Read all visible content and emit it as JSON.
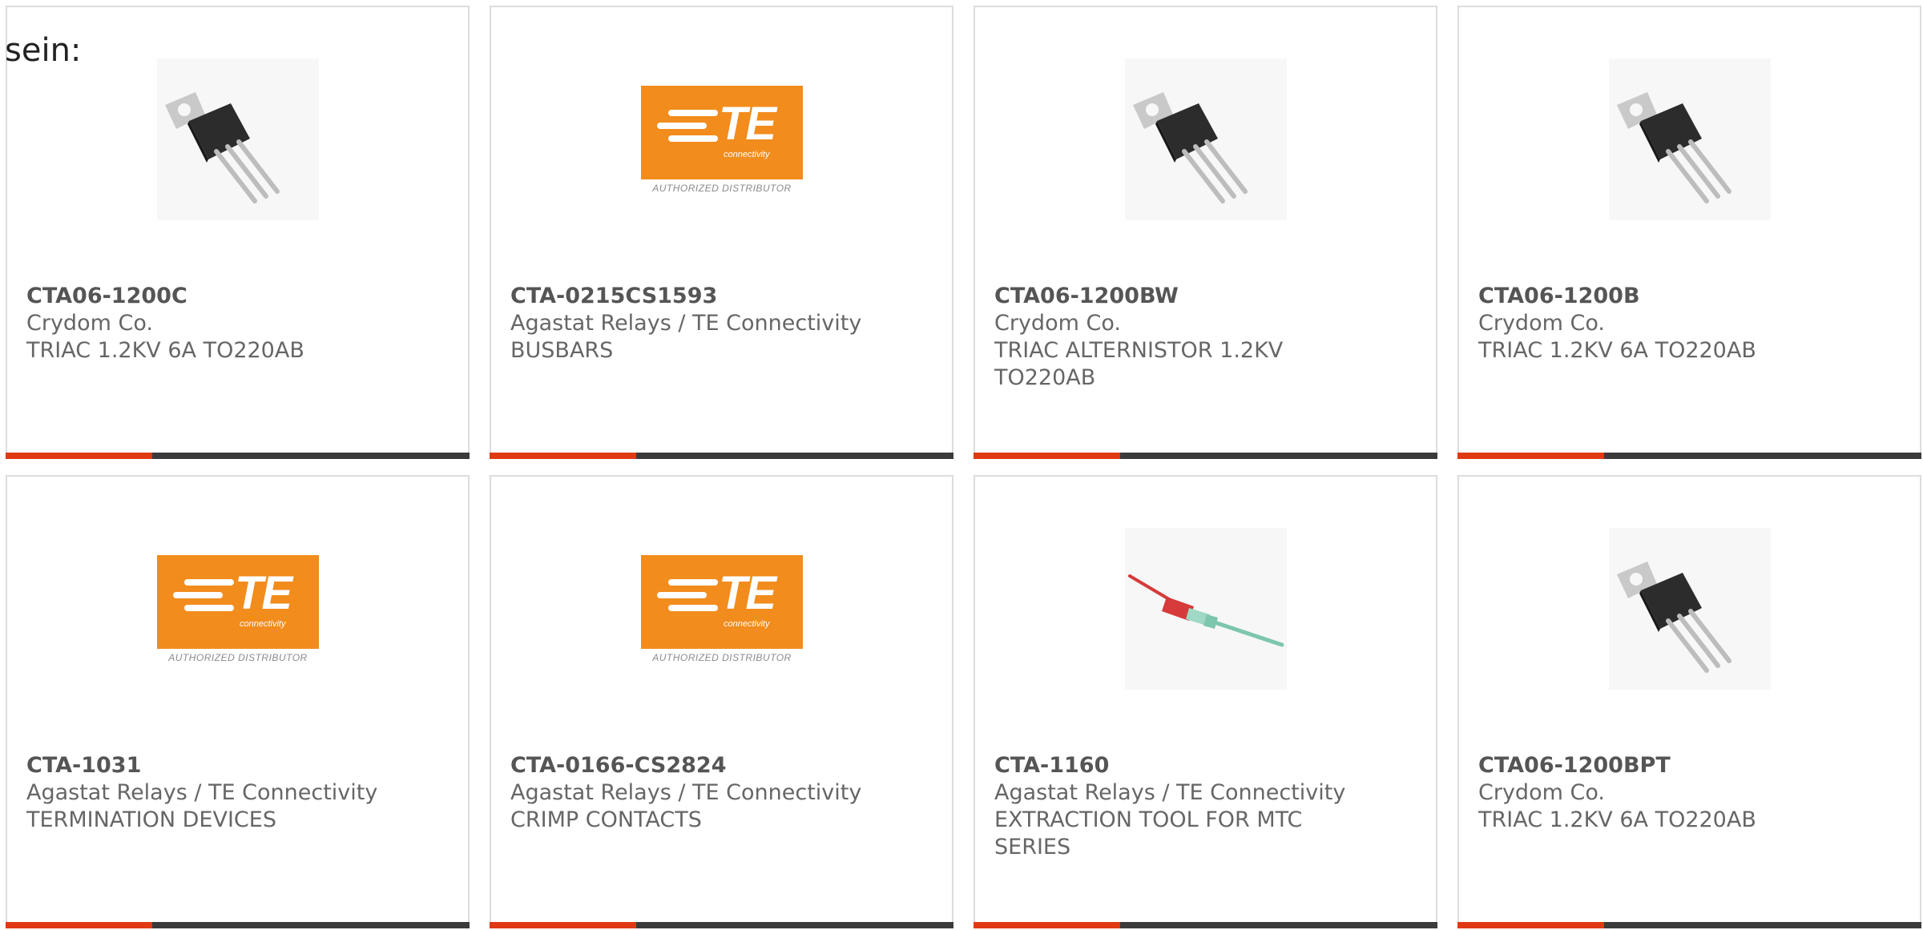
{
  "intro_text": "sein:",
  "colors": {
    "accent_bar": "#e03a12",
    "bar": "#3b3b3b",
    "te_orange": "#f28c1c"
  },
  "products": [
    {
      "part": "CTA06-1200C",
      "maker": "Crydom Co.",
      "desc": "TRIAC 1.2KV 6A TO220AB",
      "image": "to220-transistor-icon"
    },
    {
      "part": "CTA-0215CS1593",
      "maker": "Agastat Relays / TE Connectivity",
      "desc": "BUSBARS",
      "image": "te-logo"
    },
    {
      "part": "CTA06-1200BW",
      "maker": "Crydom Co.",
      "desc": "TRIAC ALTERNISTOR 1.2KV TO220AB",
      "image": "to220-transistor-icon"
    },
    {
      "part": "CTA06-1200B",
      "maker": "Crydom Co.",
      "desc": "TRIAC 1.2KV 6A TO220AB",
      "image": "to220-transistor-icon"
    },
    {
      "part": "CTA-1031",
      "maker": "Agastat Relays / TE Connectivity",
      "desc": "TERMINATION DEVICES",
      "image": "te-logo"
    },
    {
      "part": "CTA-0166-CS2824",
      "maker": "Agastat Relays / TE Connectivity",
      "desc": "CRIMP CONTACTS",
      "image": "te-logo"
    },
    {
      "part": "CTA-1160",
      "maker": "Agastat Relays / TE Connectivity",
      "desc": "EXTRACTION TOOL FOR MTC SERIES",
      "image": "extraction-tool-icon"
    },
    {
      "part": "CTA06-1200BPT",
      "maker": "Crydom Co.",
      "desc": "TRIAC 1.2KV 6A TO220AB",
      "image": "to220-transistor-icon"
    }
  ],
  "te_logo": {
    "letters": "TE",
    "sub": "connectivity",
    "caption": "AUTHORIZED DISTRIBUTOR"
  }
}
